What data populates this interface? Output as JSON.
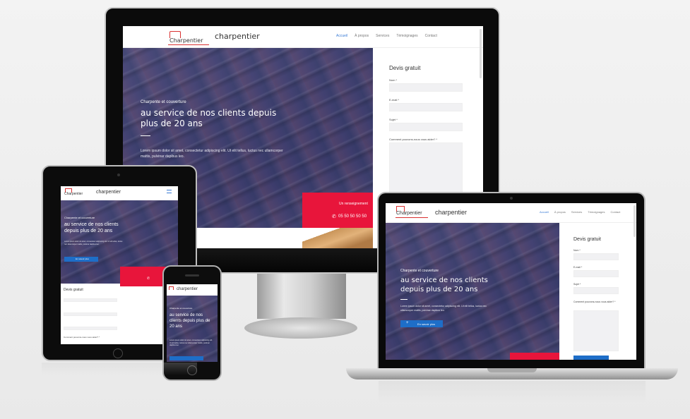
{
  "site": {
    "logo_text": "Charpentier",
    "brand": "charpentier",
    "nav": [
      "Accueil",
      "À propos",
      "Services",
      "Témoignages",
      "Contact"
    ],
    "hero_kicker": "Charpente et couverture",
    "hero_title_line1": "au service de nos clients depuis",
    "hero_title_line2": "plus de 20 ans",
    "hero_body": "Lorem ipsum dolor sit amet, consectetur adipiscing elit. Ut elit tellus, luctus nec ullamcorper mattis, pulvinar dapibus leo.",
    "cta_text": "Un renseignement",
    "phone": "05 50 50 50 50",
    "hero_button": "En savoir plus",
    "form": {
      "title": "Devis gratuit",
      "name_label": "Nom *",
      "email_label": "E-mail *",
      "subject_label": "Sujet *",
      "message_label": "Comment pouvons-nous vous aider? *"
    }
  },
  "tablet": {
    "hero_title": "au service de nos clients depuis plus de 20 ans"
  },
  "phone_dev": {
    "hero_title": "au service de nos clients depuis plus de 20 ans"
  },
  "laptop": {
    "hero_title_line1": "au service de nos clients",
    "hero_title_line2": "depuis plus de 20 ans"
  },
  "colors": {
    "accent_red": "#e8153b",
    "accent_blue": "#1e6ec8",
    "nav_active": "#3a7bd5"
  }
}
